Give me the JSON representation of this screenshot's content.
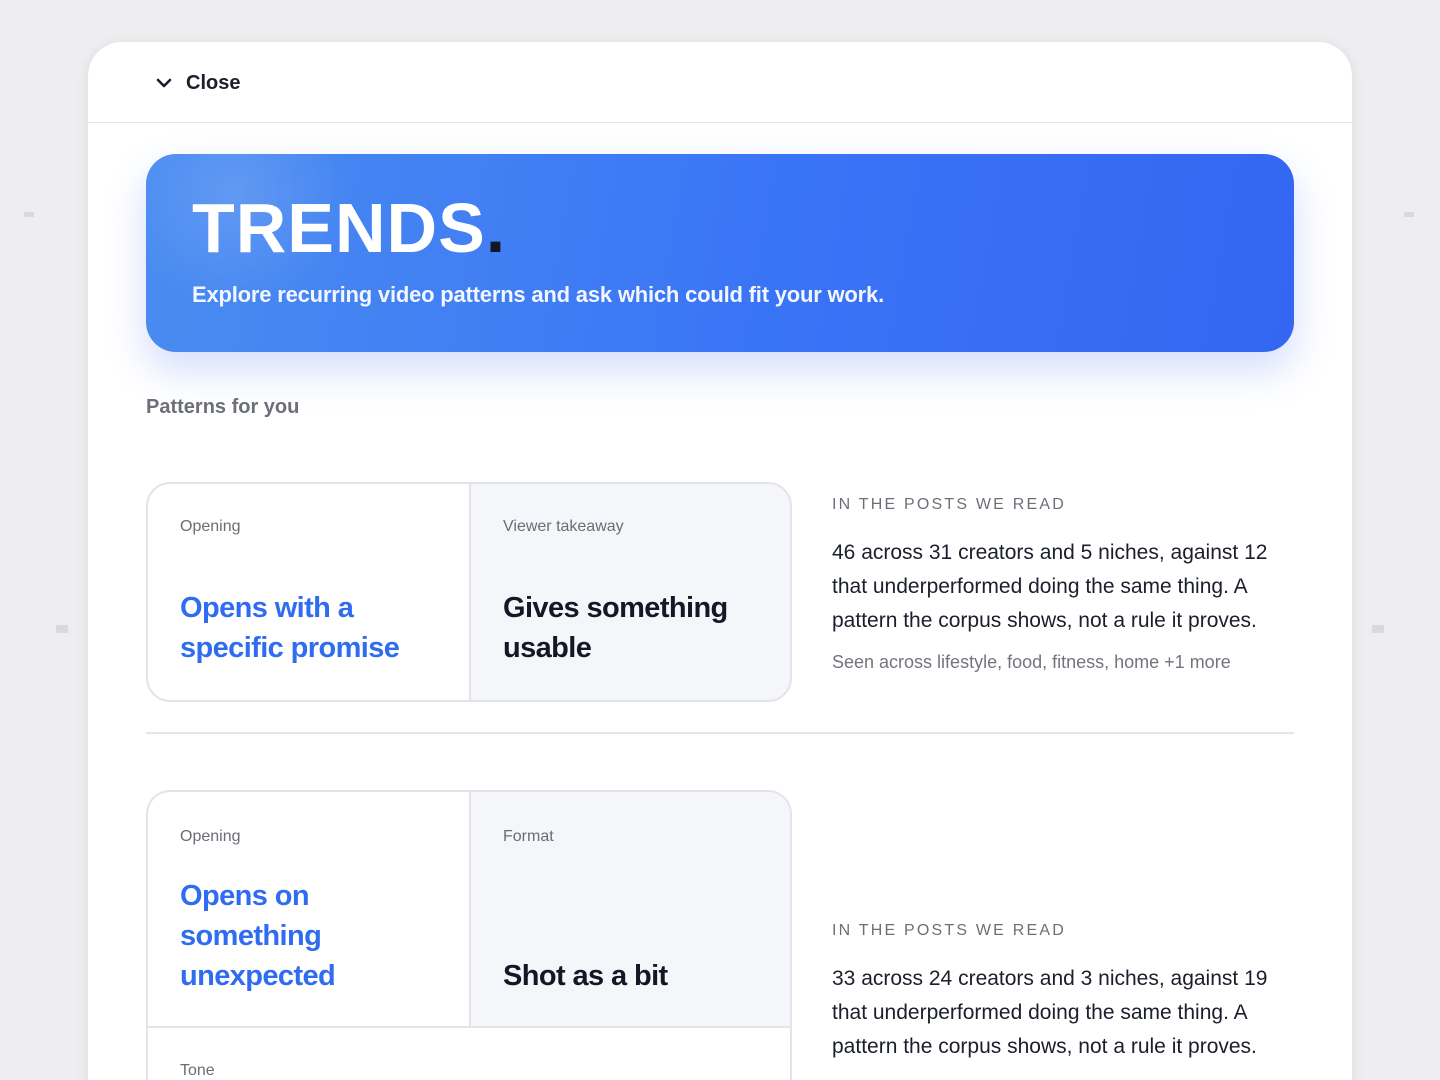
{
  "close": {
    "label": "Close"
  },
  "hero": {
    "title": "TRENDS",
    "dot": ".",
    "subtitle": "Explore recurring video patterns and ask which could fit your work."
  },
  "section": {
    "label": "Patterns for you"
  },
  "patterns": [
    {
      "left_label": "Opening",
      "left_value": "Opens with a specific promise",
      "right_label": "Viewer takeaway",
      "right_value": "Gives something usable",
      "eyebrow": "IN THE POSTS WE READ",
      "body": "46 across 31 creators and 5 niches, against 12 that underperformed doing the same thing. A pattern the corpus shows, not a rule it proves.",
      "foot": "Seen across lifestyle, food, fitness, home +1 more"
    },
    {
      "left_label": "Opening",
      "left_value": "Opens on something unexpected",
      "right_label": "Format",
      "right_value": "Shot as a bit",
      "third_label": "Tone",
      "eyebrow": "IN THE POSTS WE READ",
      "body": "33 across 24 creators and 3 niches, against 19 that underperformed doing the same thing. A pattern the corpus shows, not a rule it proves."
    }
  ],
  "colors": {
    "accent_blue": "#2f6cf0",
    "hero_blue": "#3a74f6",
    "text_dark": "#141826"
  },
  "icons": {
    "close": "chevron-down-icon"
  }
}
